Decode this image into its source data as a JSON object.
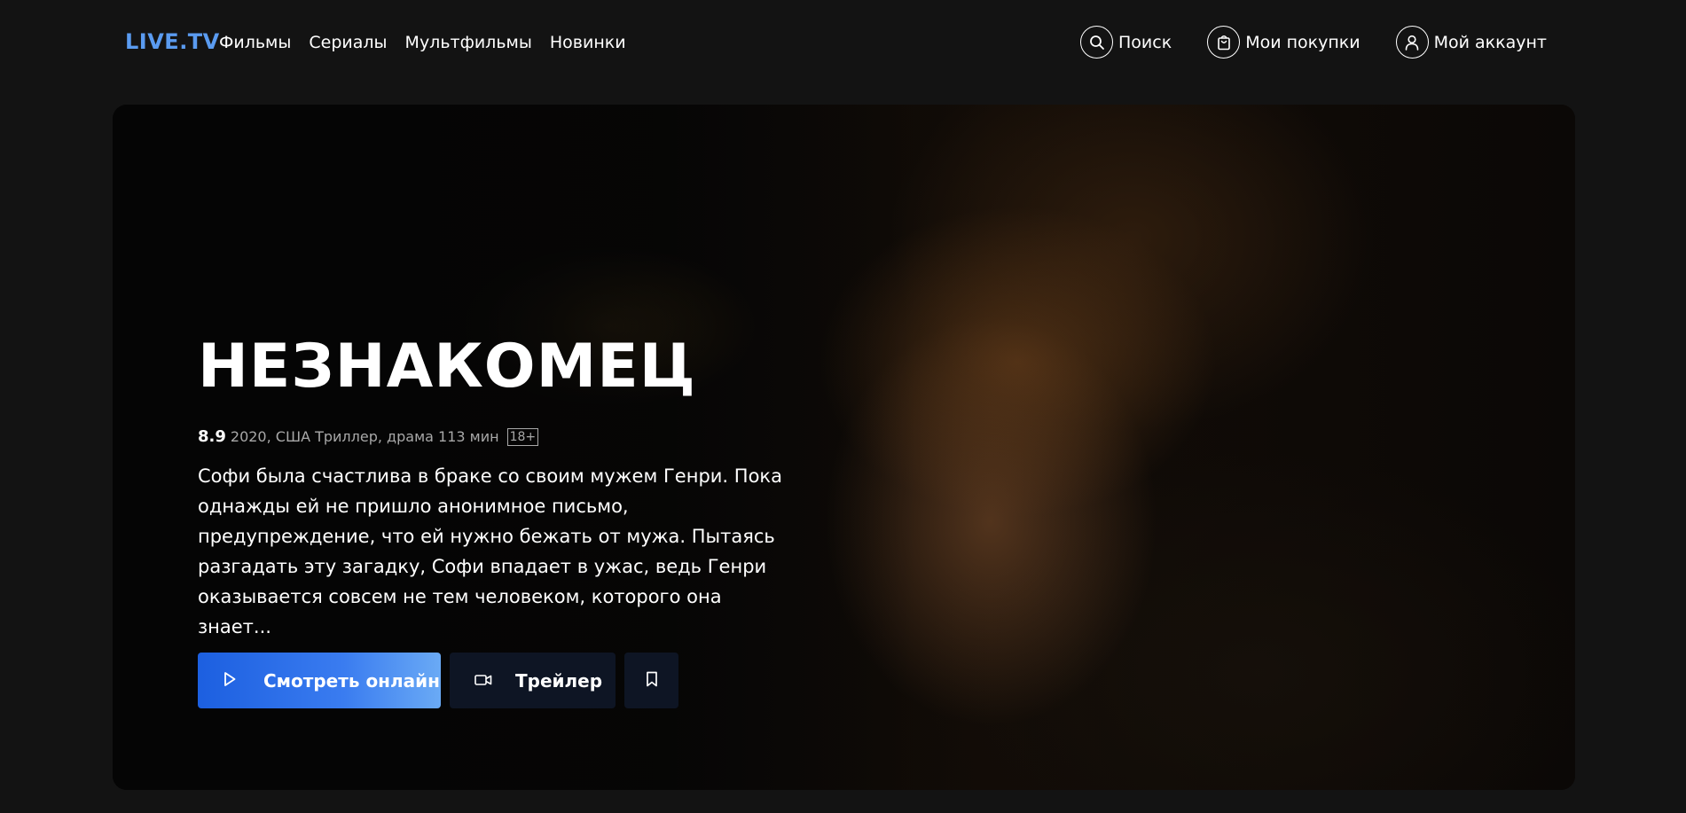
{
  "header": {
    "logo": "LIVE.TV",
    "nav": [
      {
        "label": "Фильмы"
      },
      {
        "label": "Сериалы"
      },
      {
        "label": "Мультфильмы"
      },
      {
        "label": "Новинки"
      }
    ],
    "actions": {
      "search": {
        "label": "Поиск",
        "icon": "search-icon"
      },
      "purchases": {
        "label": "Мои покупки",
        "icon": "shopping-bag-icon"
      },
      "account": {
        "label": "Мой аккаунт",
        "icon": "user-icon"
      }
    }
  },
  "hero": {
    "title": "НЕЗНАКОМЕЦ",
    "rating": "8.9",
    "info": "2020, США Триллер, драма 113 мин",
    "age": "18+",
    "description": "Софи была счастлива в браке со своим мужем Генри. Пока однажды ей не пришло анонимное письмо, предупреждение, что ей нужно бежать от мужа. Пытаясь разгадать эту загадку, Софи впадает в ужас, ведь Генри оказывается совсем не тем человеком, которого она знает...",
    "buttons": {
      "watch": {
        "label": "Смотреть онлайн",
        "icon": "play-icon"
      },
      "trailer": {
        "label": "Трейлер",
        "icon": "video-camera-icon"
      },
      "bookmark": {
        "icon": "bookmark-icon"
      }
    }
  },
  "colors": {
    "background": "#131313",
    "accent": "#5a9bf0",
    "button_primary_start": "#1c5fe0",
    "button_primary_end": "#6aaaf5",
    "button_secondary": "#0e1524",
    "text_muted": "#a8a8a8"
  }
}
